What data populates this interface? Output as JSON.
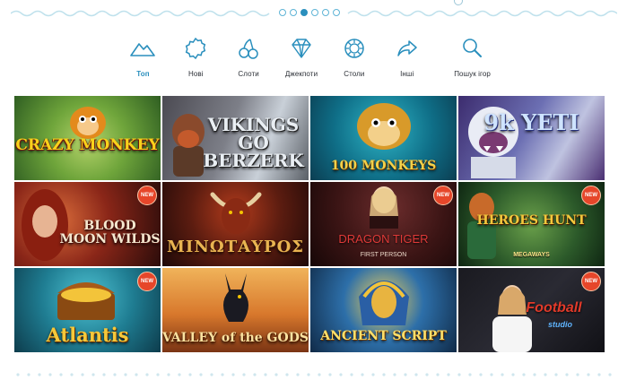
{
  "pagination": {
    "count": 6,
    "active_index": 2
  },
  "nav": {
    "items": [
      {
        "label": "Топ",
        "icon": "mountain-icon",
        "active": true
      },
      {
        "label": "Нові",
        "icon": "badge-icon",
        "active": false
      },
      {
        "label": "Слоти",
        "icon": "cherries-icon",
        "active": false
      },
      {
        "label": "Джекпоти",
        "icon": "diamond-icon",
        "active": false
      },
      {
        "label": "Столи",
        "icon": "chip-icon",
        "active": false
      },
      {
        "label": "Інші",
        "icon": "share-arrow-icon",
        "active": false
      },
      {
        "label": "Пошук ігор",
        "icon": "search-icon",
        "active": false
      }
    ],
    "accent_color": "#2a8fbd"
  },
  "games": [
    {
      "title": "CRAZY MONKEY",
      "new": false
    },
    {
      "title": "VIKINGS GO BERZERK",
      "new": false
    },
    {
      "title": "100 MONKEYS",
      "new": false
    },
    {
      "title": "9k YETI",
      "new": false
    },
    {
      "title": "BLOOD MOON WILDS",
      "new": true
    },
    {
      "title": "ΜΙΝΩΤΑΥΡΟΣ",
      "new": false
    },
    {
      "title": "DRAGON TIGER",
      "subtitle": "FIRST PERSON",
      "new": true
    },
    {
      "title": "HEROES HUNT",
      "subtitle": "MEGAWAYS",
      "new": true
    },
    {
      "title": "Atlantis",
      "new": true
    },
    {
      "title": "VALLEY of the GODS",
      "new": false
    },
    {
      "title": "ANCIENT SCRIPT",
      "new": false
    },
    {
      "title": "Football",
      "subtitle": "studio",
      "new": true
    }
  ],
  "badge_label": "NEW"
}
